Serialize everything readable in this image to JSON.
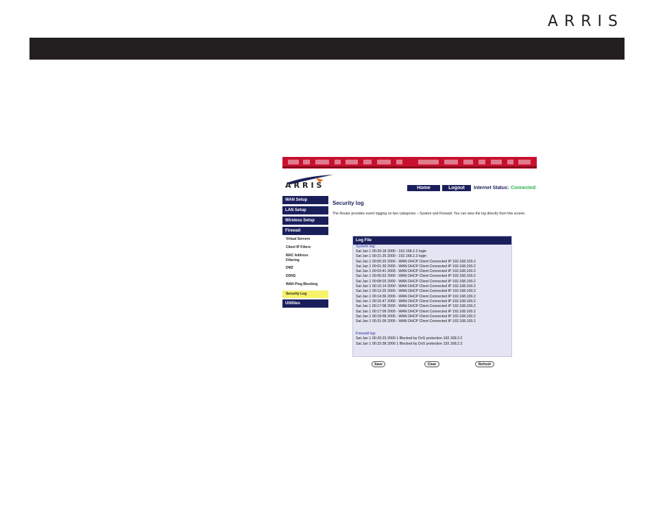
{
  "header": {
    "brand": "ARRIS"
  },
  "screenshot": {
    "logo_text": "ARRIS",
    "nav": {
      "home": "Home",
      "logout": "Logout"
    },
    "status": {
      "label": "Internet Status:",
      "value": "Connected"
    },
    "sidebar": {
      "wan": "WAN Setup",
      "lan": "LAN Setup",
      "wireless": "Wireless Setup",
      "firewall": "Firewall",
      "sub": {
        "virtual": "Virtual Servers",
        "client": "Client IP Filters",
        "mac": "MAC Address Filtering",
        "dmz": "DMZ",
        "ddns": "DDNS",
        "ping": "WAN Ping Blocking",
        "security": "Security Log"
      },
      "utilities": "Utilities"
    },
    "title": "Security log",
    "description": "The Router provides event logging on two categories – System and Firewall. You can view the log directly from this screen.",
    "log": {
      "header": "Log File",
      "system_label": "System log:",
      "system": [
        "Sat Jan 1 00:20:18 2000 - 192.168.2.2 login",
        "Sat Jan 1 00:21:25 2000 - 192.168.2.2 login",
        "Sat Jan 1 00:00:20 2000 - WAN DHCP Client Connected IP 192.168.100.2",
        "Sat Jan 1 00:01:30 2000 - WAN DHCP Client Connected IP 192.168.100.2",
        "Sat Jan 1 00:03:41 2000 - WAN DHCP Client Connected IP 192.168.100.2",
        "Sat Jan 1 00:05:52 2000 - WAN DHCP Client Connected IP 192.168.100.2",
        "Sat Jan 1 00:08:03 2000 - WAN DHCP Client Connected IP 192.168.100.2",
        "Sat Jan 1 00:10:14 2000 - WAN DHCP Client Connected IP 192.168.100.2",
        "Sat Jan 1 00:12:25 2000 - WAN DHCP Client Connected IP 192.168.100.2",
        "Sat Jan 1 00:14:36 2000 - WAN DHCP Client Connected IP 192.168.100.2",
        "Sat Jan 1 00:16:47 2000 - WAN DHCP Client Connected IP 192.168.100.2",
        "Sat Jan 1 00:17:08 2000 - WAN DHCP Client Connected IP 192.168.100.2",
        "Sat Jan 1 00:17:09 2000 - WAN DHCP Client Connected IP 192.168.100.2",
        "Sat Jan 1 00:18:58 2000 - WAN DHCP Client Connected IP 192.168.100.2",
        "Sat Jan 1 00:21:09 2000 - WAN DHCP Client Connected IP 192.168.100.2"
      ],
      "firewall_label": "Firewall log:",
      "firewall": [
        "Sat Jan 1 00:20:23 2000 1 Blocked by DoS protection 192.168.2.2",
        "Sat Jan 1 00:23:38 2000 1 Blocked by DoS protection 192.168.2.2"
      ]
    },
    "buttons": {
      "save": "Save",
      "clear": "Clear",
      "refresh": "Refresh"
    }
  },
  "colors": {
    "navy": "#1a1f5c",
    "red": "#c8102e",
    "green": "#2db14a",
    "highlight": "#f6f26a",
    "bar": "#231f20"
  }
}
